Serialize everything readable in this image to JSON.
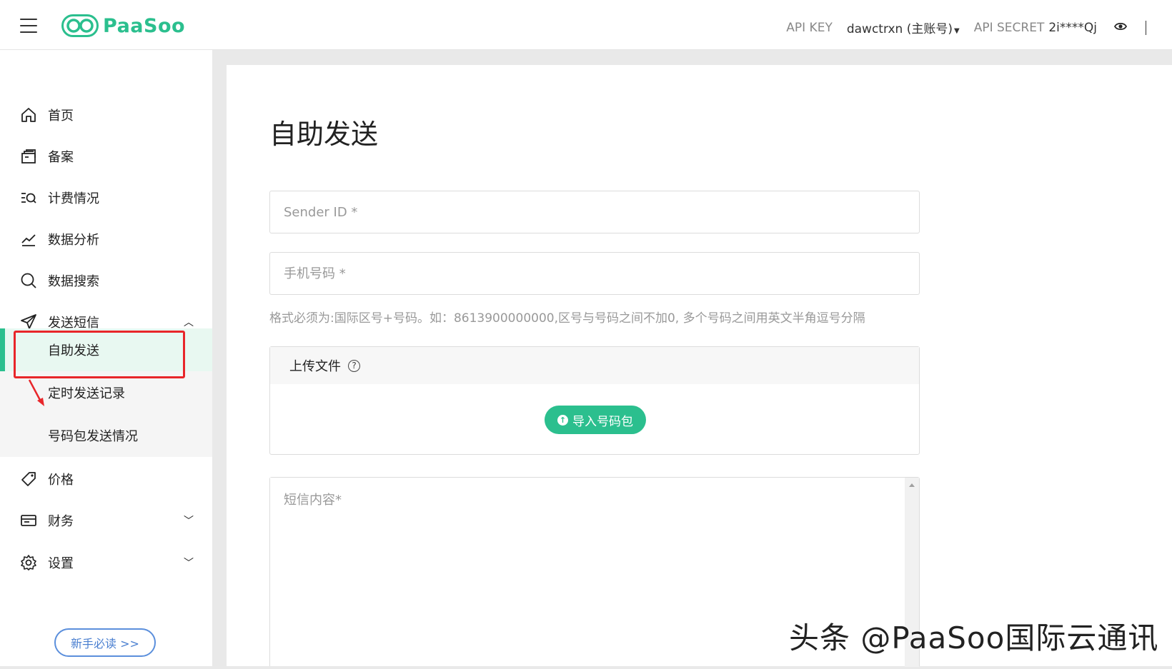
{
  "header": {
    "logo_text": "PaaSoo",
    "api_key_label": "API KEY",
    "account": "dawctrxn (主账号)",
    "api_secret_label": "API SECRET",
    "api_secret_value": "2i****Qj"
  },
  "sidebar": {
    "items": [
      {
        "label": "首页",
        "icon": "home-icon"
      },
      {
        "label": "备案",
        "icon": "document-stack-icon"
      },
      {
        "label": "计费情况",
        "icon": "billing-search-icon"
      },
      {
        "label": "数据分析",
        "icon": "line-chart-icon"
      },
      {
        "label": "数据搜索",
        "icon": "search-icon"
      },
      {
        "label": "发送短信",
        "icon": "paper-plane-icon"
      },
      {
        "label": "价格",
        "icon": "price-tag-icon"
      },
      {
        "label": "财务",
        "icon": "wallet-icon"
      },
      {
        "label": "设置",
        "icon": "gear-icon"
      }
    ],
    "sub_items": [
      {
        "label": "自助发送",
        "active": true
      },
      {
        "label": "定时发送记录",
        "active": false
      },
      {
        "label": "号码包发送情况",
        "active": false
      }
    ],
    "guide_button": "新手必读 >>"
  },
  "main": {
    "title": "自助发送",
    "sender_id_placeholder": "Sender ID *",
    "phone_placeholder": "手机号码 *",
    "hint": "格式必须为:国际区号+号码。如：8613900000000,区号与号码之间不加0, 多个号码之间用英文半角逗号分隔",
    "upload_label": "上传文件",
    "import_button": "导入号码包",
    "sms_placeholder": "短信内容*"
  },
  "watermark": "头条 @PaaSoo国际云通讯",
  "colors": {
    "accent": "#2bbf8e",
    "highlight": "#e8262a",
    "link": "#4a7fd0"
  }
}
